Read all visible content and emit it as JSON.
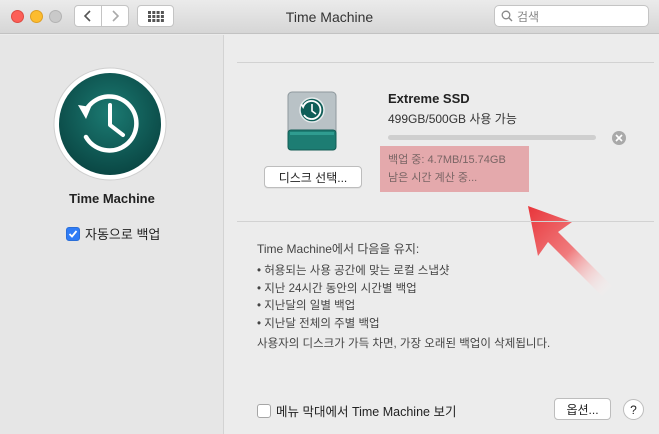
{
  "window": {
    "title": "Time Machine",
    "search_placeholder": "검색"
  },
  "sidebar": {
    "app_name": "Time Machine",
    "auto_backup_label": "자동으로 백업",
    "auto_backup_checked": true
  },
  "disk": {
    "name": "Extreme SSD",
    "capacity": "499GB/500GB 사용 가능",
    "progress_fraction": 0.0,
    "select_label": "디스크 선택...",
    "status_backup": "백업 중: 4.7MB/15.74GB",
    "status_remaining": "남은 시간 계산 중..."
  },
  "retention": {
    "title": "Time Machine에서 다음을 유지:",
    "items": [
      "• 허용되는 사용 공간에 맞는 로컬 스냅샷",
      "• 지난 24시간 동안의 시간별 백업",
      "• 지난달의 일별 백업",
      "• 지난달 전체의 주별 백업"
    ],
    "note": "사용자의 디스크가 가득 차면, 가장 오래된 백업이 삭제됩니다."
  },
  "footer": {
    "menubar_label": "메뉴 막대에서 Time Machine 보기",
    "menubar_checked": false,
    "options_label": "옵션...",
    "help_label": "?"
  },
  "colors": {
    "accent": "#2f7cf6",
    "tm_green": "#0e5a56",
    "highlight": "#e3a3a6",
    "arrow": "#e8353a"
  }
}
